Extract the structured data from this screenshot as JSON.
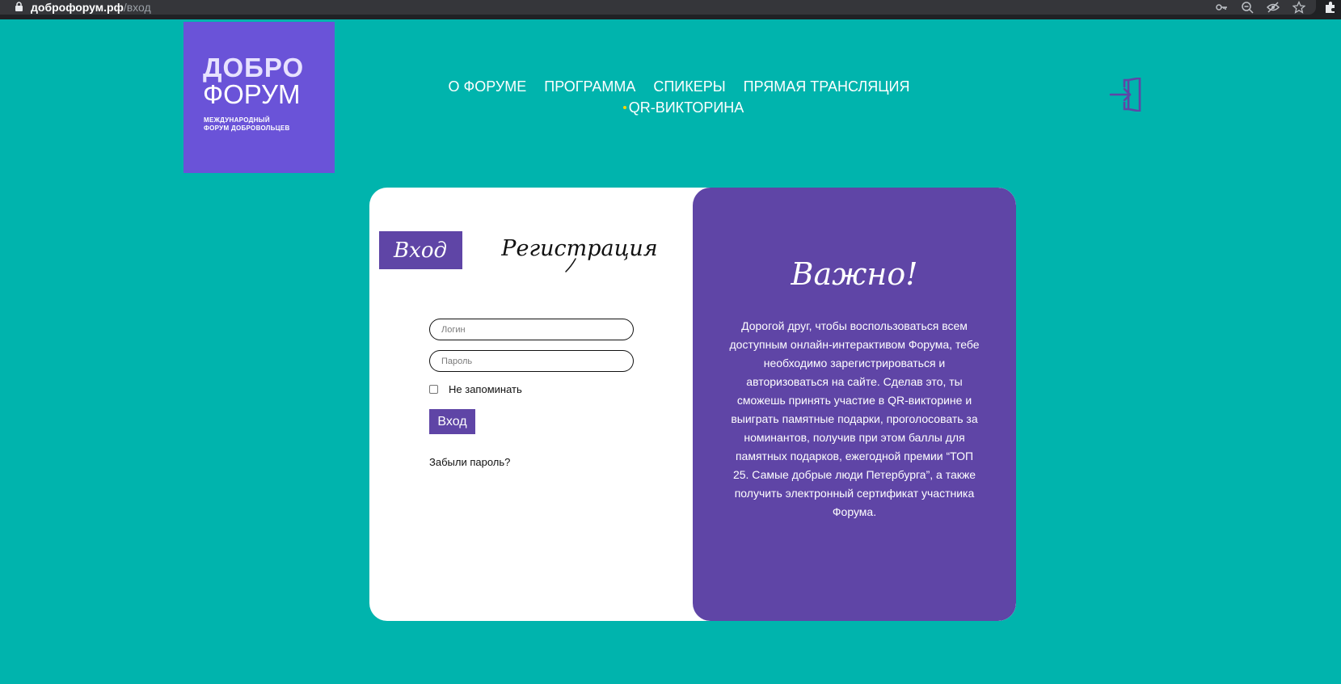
{
  "browser": {
    "url_host": "доброфорум.рф",
    "url_path": "/вход"
  },
  "logo": {
    "line1": "ДОБРО",
    "line2": "ФОРУМ",
    "sub1": "МЕЖДУНАРОДНЫЙ",
    "sub2": "ФОРУМ ДОБРОВОЛЬЦЕВ"
  },
  "nav": {
    "items": [
      "О ФОРУМЕ",
      "ПРОГРАММА",
      "СПИКЕРЫ",
      "ПРЯМАЯ ТРАНСЛЯЦИЯ",
      "QR-ВИКТОРИНА"
    ],
    "dot_color": "#ffd400"
  },
  "tabs": {
    "login": "Вход",
    "register": "Регистрация"
  },
  "form": {
    "login_placeholder": "Логин",
    "password_placeholder": "Пароль",
    "remember_label": "Не запоминать",
    "submit_label": "Вход",
    "forgot_label": "Забыли пароль?"
  },
  "info": {
    "title": "Важно!",
    "text": "Дорогой друг, чтобы воспользоваться всем доступным онлайн-интерактивом Форума, тебе необходимо зарегистрироваться и авторизоваться на сайте. Сделав это, ты сможешь принять участие в QR-викторине и выиграть памятные подарки, проголосовать за номинантов, получив при этом баллы для памятных подарков, ежегодной премии “ТОП 25. Самые добрые люди Петербурга”, а также получить электронный сертификат участника Форума."
  },
  "icons": {
    "lock": "lock-icon",
    "key": "key-icon",
    "zoom": "zoom-out-icon",
    "eye": "eye-off-icon",
    "star": "star-icon",
    "puzzle": "puzzle-icon",
    "login": "login-door-icon"
  },
  "colors": {
    "background": "#00b4ad",
    "logo": "#6a53d8",
    "accent": "#5f45a6"
  }
}
